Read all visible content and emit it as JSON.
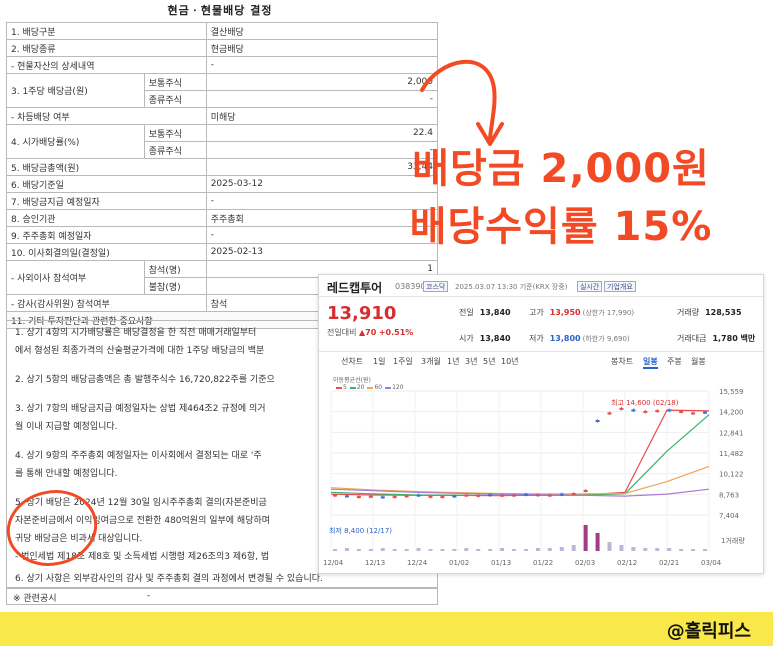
{
  "doc": {
    "title": "현금ㆍ현물배당 결정",
    "rows": {
      "r1": [
        "1. 배당구분",
        "결산배당"
      ],
      "r2": [
        "2. 배당종류",
        "현금배당"
      ],
      "r3": [
        "- 현물자산의 상세내역",
        "-"
      ],
      "r4": [
        "3. 1주당 배당금(원)",
        "보통주식",
        "2,000",
        "종류주식",
        "-"
      ],
      "r5": [
        "- 차등배당 여부",
        "미해당"
      ],
      "r6": [
        "4. 시가배당률(%)",
        "보통주식",
        "22.4",
        "종류주식",
        "-"
      ],
      "r7": [
        "5. 배당금총액(원)",
        "33,44"
      ],
      "r8": [
        "6. 배당기준일",
        "2025-03-12"
      ],
      "r9": [
        "7. 배당금지급 예정일자",
        "-"
      ],
      "r10": [
        "8. 승인기관",
        "주주총회"
      ],
      "r11": [
        "9. 주주총회 예정일자",
        "-"
      ],
      "r12": [
        "10. 이사회결의일(결정일)",
        "2025-02-13"
      ],
      "r13": [
        "- 사외이사 참석여부",
        "참석(명)",
        "1",
        "불참(명)"
      ],
      "r14": [
        "- 감사(감사위원) 참석여부",
        "참석"
      ],
      "r15": [
        "11. 기타 투자판단과 관련한 중요사항"
      ]
    },
    "notes": [
      "1. 상기 4항의 시가배당률은 배당결정을 한 직전 매매거래일부터",
      "에서 형성된 최종가격의 산술평균가격에 대한 1주당 배당금의 백분",
      "2. 상기 5항의 배당금총액은 총 발행주식수 16,720,822주를 기준으",
      "3. 상기 7항의 배당금지급 예정일자는 상법 제464조2 규정에 의거",
      "월 이내 지급할 예정입니다.",
      "4. 상기 9항의 주주총회 예정일자는 이사회에서 결정되는 대로 '주",
      "를 통해 안내할 예정입니다.",
      "5. 상기 배당은 2024년 12월 30일 임시주주총회 결의(자본준비금",
      "자본준비금에서 이익잉여금으로 전환한 480억원의 일부에 해당하며",
      "귀당 배당금은 비과세 대상입니다.",
      "- 법인세법 제18조 제8호 및 소득세법 시행령 제26조의3 제6항, 법",
      "6. 상기 사항은 외부감사인의 감사 및 주주총회 결의 과정에서 변경될 수 있습니다."
    ],
    "related_label": "※ 관련공시",
    "related_value": "-"
  },
  "headline": {
    "line1": "배당금 2,000원",
    "line2": "배당수익률 15%"
  },
  "stock": {
    "name": "레드캡투어",
    "code": "038390",
    "badge1": "코스닥",
    "time": "2025.03.07 13:30 기준(KRX 장중)",
    "badge2": "실시간",
    "badge3": "기업개요",
    "price": "13,910",
    "change_label": "전일대비",
    "change_value": "▲70",
    "change_pct": "+0.51%",
    "prev_label": "전일",
    "prev": "13,840",
    "high_label": "고가",
    "high": "13,950",
    "high_limit": "(상한가 17,990)",
    "volume_label": "거래량",
    "volume": "128,535",
    "open_label": "시가",
    "open": "13,840",
    "low_label": "저가",
    "low": "13,800",
    "low_limit": "(하한가 9,690)",
    "value_label": "거래대금",
    "value": "1,780 백만",
    "tabs": [
      "선차트",
      "1일",
      "1주일",
      "3개월",
      "1년",
      "3년",
      "5년",
      "10년"
    ],
    "view_tabs": [
      "봉차트",
      "일봉",
      "주봉",
      "월봉"
    ],
    "active_view": "일봉",
    "legend_title": "이동평균선(원)",
    "legend_items": [
      "5",
      "20",
      "60",
      "120"
    ],
    "legend_colors": [
      "#e94c4c",
      "#3bb36a",
      "#f0a457",
      "#a77bd6"
    ],
    "high_annotation": "최고 14,600 (02/18)",
    "low_annotation": "최저 8,400 (12/17)",
    "volume_tag": "1거래량"
  },
  "chart_data": {
    "type": "line",
    "x": [
      "12/04",
      "12/13",
      "12/24",
      "01/02",
      "01/13",
      "01/22",
      "02/03",
      "02/12",
      "02/21",
      "03/04"
    ],
    "ylim": [
      7404,
      15559
    ],
    "y_ticks": [
      "15,559",
      "14,200",
      "12,841",
      "11,482",
      "10,122",
      "8,763",
      "7,404"
    ],
    "series": [
      {
        "name": "5",
        "color": "#e94c4c",
        "values": [
          8780,
          8720,
          8700,
          8690,
          8680,
          8700,
          8720,
          8900,
          14300,
          14250
        ]
      },
      {
        "name": "20",
        "color": "#3bb36a",
        "values": [
          8900,
          8800,
          8720,
          8700,
          8690,
          8700,
          8710,
          8800,
          11600,
          14000
        ]
      },
      {
        "name": "60",
        "color": "#f0a457",
        "values": [
          9200,
          9050,
          8950,
          8880,
          8820,
          8790,
          8800,
          8820,
          9600,
          10600
        ]
      },
      {
        "name": "120",
        "color": "#a77bd6",
        "values": [
          9100,
          9000,
          8900,
          8830,
          8780,
          8740,
          8700,
          8650,
          8780,
          9100
        ]
      }
    ]
  },
  "banner": {
    "handle": "@홀릭피스"
  },
  "colors": {
    "accent": "#f24a24",
    "banner": "#f9e84a",
    "up": "#d62e2e",
    "down": "#2b62c9"
  }
}
